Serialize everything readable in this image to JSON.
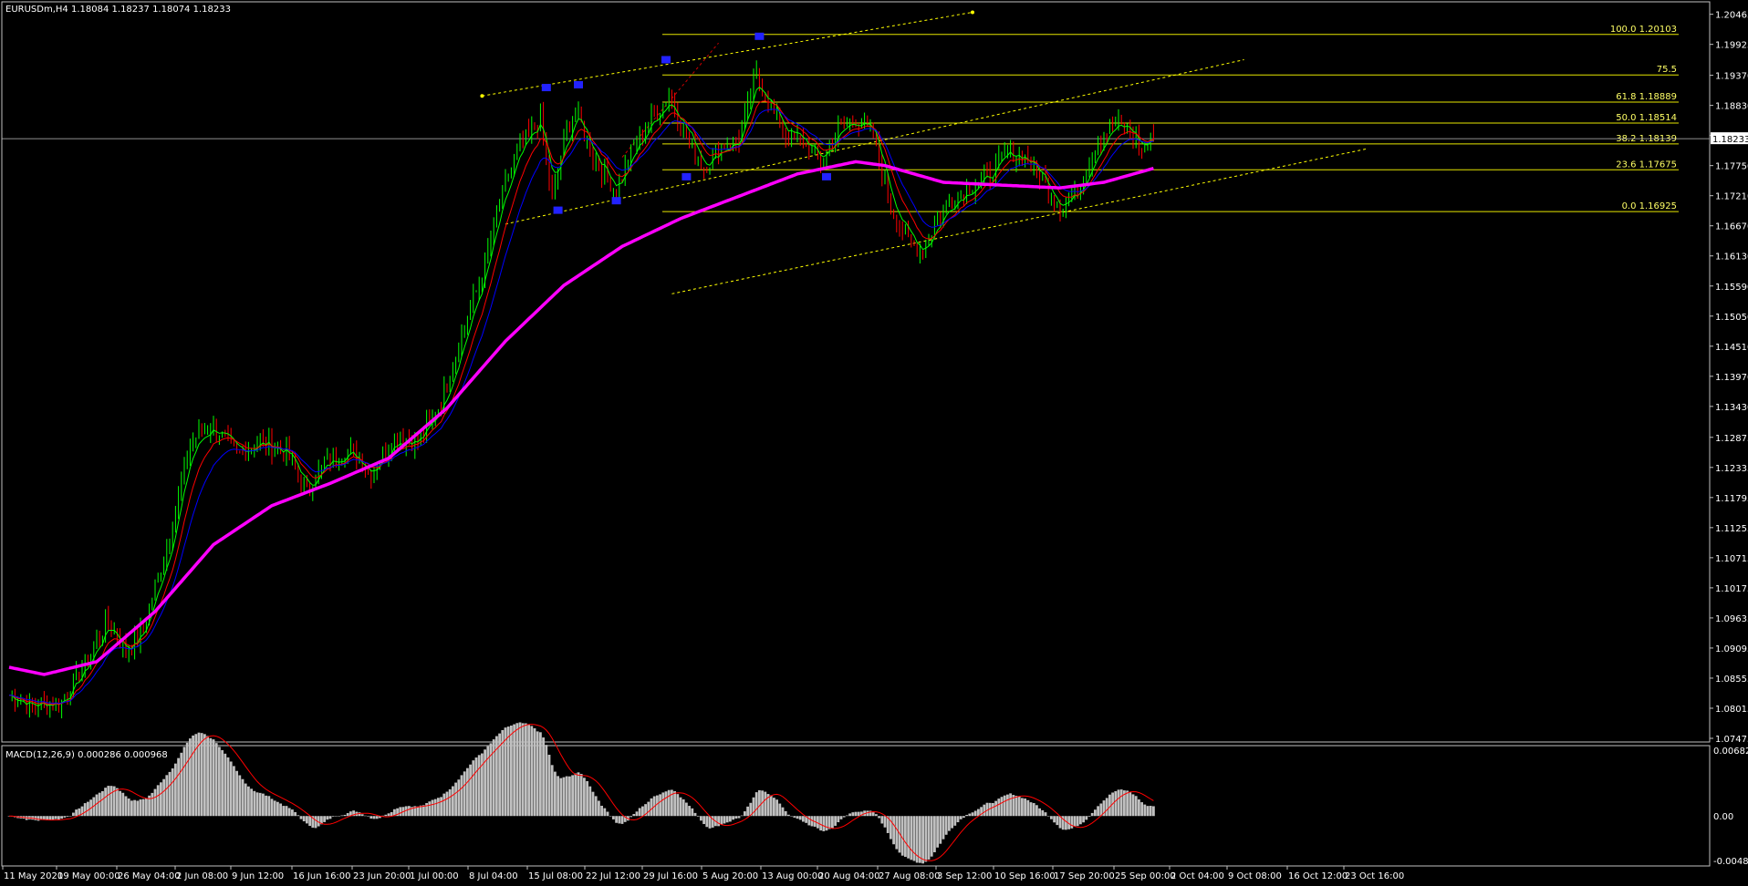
{
  "header": {
    "symbol": "EURUSDm,H4",
    "ohlc": "1.18084 1.18237 1.18074 1.18233"
  },
  "price_badge": "1.18233",
  "macd": {
    "label": "MACD(12,26,9) 0.000286 0.000968",
    "y_ticks": [
      "0.006822",
      "0.00",
      "-0.0048"
    ]
  },
  "colors": {
    "background": "#000000",
    "frame": "#c0c0c0",
    "fib": "#e6e600",
    "channel": "#ffff00",
    "ma_long": "#ff00ff",
    "ma_fast": "#00ff00",
    "ma_mid": "#ff0000",
    "ma_slow": "#0000ff",
    "bull": "#00ff00",
    "bear": "#ff0000",
    "histogram": "#c0c0c0",
    "signal": "#ff0000",
    "marker": "#2222ff"
  },
  "fib_levels": [
    {
      "label": "100.0 1.20103",
      "price": 1.20103
    },
    {
      "label": "75.5",
      "price": 1.19376
    },
    {
      "label": "61.8 1.18889",
      "price": 1.18889
    },
    {
      "label": "50.0 1.18514",
      "price": 1.18514
    },
    {
      "label": "38.2 1.18139",
      "price": 1.18139
    },
    {
      "label": "23.6 1.17675",
      "price": 1.17675
    },
    {
      "label": "0.0 1.16925",
      "price": 1.16925
    }
  ],
  "chart_data": {
    "type": "candlestick",
    "title": "EURUSDm,H4",
    "ylim": [
      1.07475,
      1.2059
    ],
    "y_ticks": [
      "1.20465",
      "1.19925",
      "1.19370",
      "1.18830",
      "1.18290",
      "1.17750",
      "1.17210",
      "1.16670",
      "1.16130",
      "1.15590",
      "1.15050",
      "1.14510",
      "1.13970",
      "1.13430",
      "1.12875",
      "1.12335",
      "1.11795",
      "1.11255",
      "1.10715",
      "1.10175",
      "1.09635",
      "1.09095",
      "1.08555",
      "1.08015",
      "1.07475"
    ],
    "x_ticks": [
      "11 May 2020",
      "19 May 00:00",
      "26 May 04:00",
      "2 Jun 08:00",
      "9 Jun 12:00",
      "16 Jun 16:00",
      "23 Jun 20:00",
      "1 Jul 00:00",
      "8 Jul 04:00",
      "15 Jul 08:00",
      "22 Jul 12:00",
      "29 Jul 16:00",
      "5 Aug 20:00",
      "13 Aug 00:00",
      "20 Aug 04:00",
      "27 Aug 08:00",
      "3 Sep 12:00",
      "10 Sep 16:00",
      "17 Sep 20:00",
      "25 Sep 00:00",
      "2 Oct 04:00",
      "9 Oct 08:00",
      "16 Oct 12:00",
      "23 Oct 16:00"
    ],
    "bar_spacing": 3.2,
    "last_close": 1.18233,
    "anchors": [
      [
        0,
        1.0825
      ],
      [
        8,
        1.0805
      ],
      [
        18,
        1.0815
      ],
      [
        26,
        1.088
      ],
      [
        34,
        1.096
      ],
      [
        40,
        1.09
      ],
      [
        46,
        1.0945
      ],
      [
        55,
        1.111
      ],
      [
        62,
        1.128
      ],
      [
        70,
        1.131
      ],
      [
        78,
        1.1255
      ],
      [
        86,
        1.128
      ],
      [
        95,
        1.126
      ],
      [
        102,
        1.119
      ],
      [
        108,
        1.124
      ],
      [
        116,
        1.1265
      ],
      [
        124,
        1.1225
      ],
      [
        132,
        1.129
      ],
      [
        140,
        1.128
      ],
      [
        148,
        1.135
      ],
      [
        154,
        1.1455
      ],
      [
        162,
        1.158
      ],
      [
        168,
        1.171
      ],
      [
        174,
        1.18
      ],
      [
        182,
        1.186
      ],
      [
        186,
        1.171
      ],
      [
        190,
        1.182
      ],
      [
        194,
        1.188
      ],
      [
        200,
        1.179
      ],
      [
        208,
        1.173
      ],
      [
        214,
        1.181
      ],
      [
        220,
        1.186
      ],
      [
        226,
        1.19
      ],
      [
        232,
        1.183
      ],
      [
        238,
        1.177
      ],
      [
        244,
        1.181
      ],
      [
        250,
        1.182
      ],
      [
        256,
        1.194
      ],
      [
        260,
        1.189
      ],
      [
        266,
        1.183
      ],
      [
        272,
        1.182
      ],
      [
        278,
        1.178
      ],
      [
        284,
        1.184
      ],
      [
        290,
        1.186
      ],
      [
        296,
        1.183
      ],
      [
        302,
        1.17
      ],
      [
        308,
        1.164
      ],
      [
        313,
        1.162
      ],
      [
        318,
        1.168
      ],
      [
        324,
        1.172
      ],
      [
        330,
        1.174
      ],
      [
        336,
        1.176
      ],
      [
        342,
        1.18
      ],
      [
        348,
        1.179
      ],
      [
        354,
        1.175
      ],
      [
        360,
        1.17
      ],
      [
        366,
        1.173
      ],
      [
        372,
        1.181
      ],
      [
        378,
        1.185
      ],
      [
        384,
        1.184
      ],
      [
        388,
        1.18
      ],
      [
        392,
        1.1825
      ]
    ],
    "series": [
      {
        "name": "MA fast",
        "color": "#00ff00"
      },
      {
        "name": "MA mid",
        "color": "#ff0000"
      },
      {
        "name": "MA slow",
        "color": "#0000ff"
      },
      {
        "name": "MA long",
        "color": "#ff00ff"
      }
    ],
    "fib_top": 1.20103,
    "fib_bottom": 1.16925,
    "markers": [
      {
        "bar": 184,
        "price": 1.1915
      },
      {
        "bar": 195,
        "price": 1.192
      },
      {
        "bar": 188,
        "price": 1.1695
      },
      {
        "bar": 208,
        "price": 1.1712
      },
      {
        "bar": 225,
        "price": 1.1965
      },
      {
        "bar": 232,
        "price": 1.1755
      },
      {
        "bar": 257,
        "price": 1.2007
      },
      {
        "bar": 280,
        "price": 1.1755
      }
    ],
    "channels": [
      {
        "from": [
          162,
          1.19
        ],
        "to": [
          330,
          1.205
        ],
        "arrow": true
      },
      {
        "from": [
          170,
          1.167
        ],
        "to": [
          423,
          1.1965
        ],
        "arrow": false
      },
      {
        "from": [
          227,
          1.1545
        ],
        "to": [
          465,
          1.1805
        ],
        "arrow": false
      },
      {
        "from": [
          210,
          1.179
        ],
        "to": [
          243,
          1.1995
        ],
        "arrow": false,
        "red": true
      }
    ],
    "macd_ylim": [
      -0.0052,
      0.0075
    ]
  }
}
